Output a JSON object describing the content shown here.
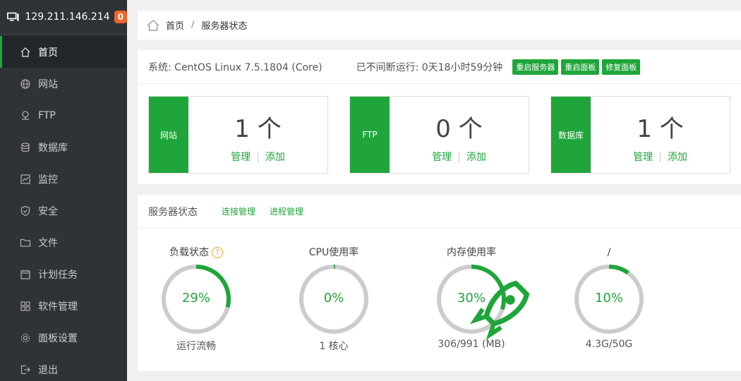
{
  "sidebar": {
    "host": "129.211.146.214",
    "badge": "0",
    "items": [
      {
        "label": "首页"
      },
      {
        "label": "网站"
      },
      {
        "label": "FTP"
      },
      {
        "label": "数据库"
      },
      {
        "label": "监控"
      },
      {
        "label": "安全"
      },
      {
        "label": "文件"
      },
      {
        "label": "计划任务"
      },
      {
        "label": "软件管理"
      },
      {
        "label": "面板设置"
      },
      {
        "label": "退出"
      }
    ]
  },
  "breadcrumb": {
    "home": "首页",
    "current": "服务器状态"
  },
  "system": {
    "os": "系统: CentOS Linux 7.5.1804 (Core)",
    "uptime": "已不间断运行: 0天18小时59分钟",
    "buttons": [
      "重启服务器",
      "重启面板",
      "修复面板"
    ]
  },
  "cards": [
    {
      "label": "网站",
      "count": "1 个",
      "manage": "管理",
      "add": "添加"
    },
    {
      "label": "FTP",
      "count": "0 个",
      "manage": "管理",
      "add": "添加"
    },
    {
      "label": "数据库",
      "count": "1 个",
      "manage": "管理",
      "add": "添加"
    }
  ],
  "status": {
    "title": "服务器状态",
    "links": [
      "连接管理",
      "进程管理"
    ],
    "gauges": [
      {
        "title": "负载状态",
        "percent": 29,
        "display": "29%",
        "bottom": "运行流畅",
        "help": "?"
      },
      {
        "title": "CPU使用率",
        "percent": 0,
        "display": "0%",
        "bottom": "1 核心"
      },
      {
        "title": "内存使用率",
        "percent": 30,
        "display": "30%",
        "bottom": "306/991 (MB)"
      },
      {
        "title": "/",
        "percent": 10,
        "display": "10%",
        "bottom": "4.3G/50G"
      }
    ]
  },
  "colors": {
    "accent": "#20a53a",
    "ring_bg": "#cccccc",
    "sidebar_bg": "#2f3236",
    "badge": "#f0652a"
  }
}
